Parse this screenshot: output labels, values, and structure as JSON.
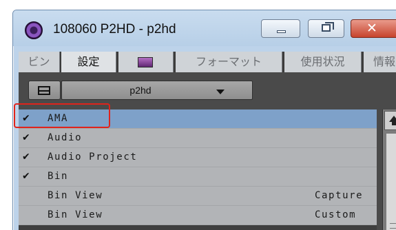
{
  "window": {
    "title": "108060 P2HD - p2hd",
    "close_glyph": "✕"
  },
  "tabs": [
    {
      "label": "ビン"
    },
    {
      "label": "設定"
    },
    {
      "label": ""
    },
    {
      "label": "フォーマット"
    },
    {
      "label": "使用状況"
    },
    {
      "label": "情報"
    }
  ],
  "toolbar": {
    "dropdown_value": "p2hd"
  },
  "settings": {
    "rows": [
      {
        "checked": true,
        "check": "✔",
        "name": "AMA",
        "type": ""
      },
      {
        "checked": true,
        "check": "✔",
        "name": "Audio",
        "type": ""
      },
      {
        "checked": true,
        "check": "✔",
        "name": "Audio Project",
        "type": ""
      },
      {
        "checked": true,
        "check": "✔",
        "name": "Bin",
        "type": ""
      },
      {
        "checked": false,
        "check": "",
        "name": "Bin View",
        "type": "Capture"
      },
      {
        "checked": false,
        "check": "",
        "name": "Bin View",
        "type": "Custom"
      }
    ]
  },
  "colors": {
    "selection": "#7ea1c9",
    "highlight": "#e0231b"
  }
}
